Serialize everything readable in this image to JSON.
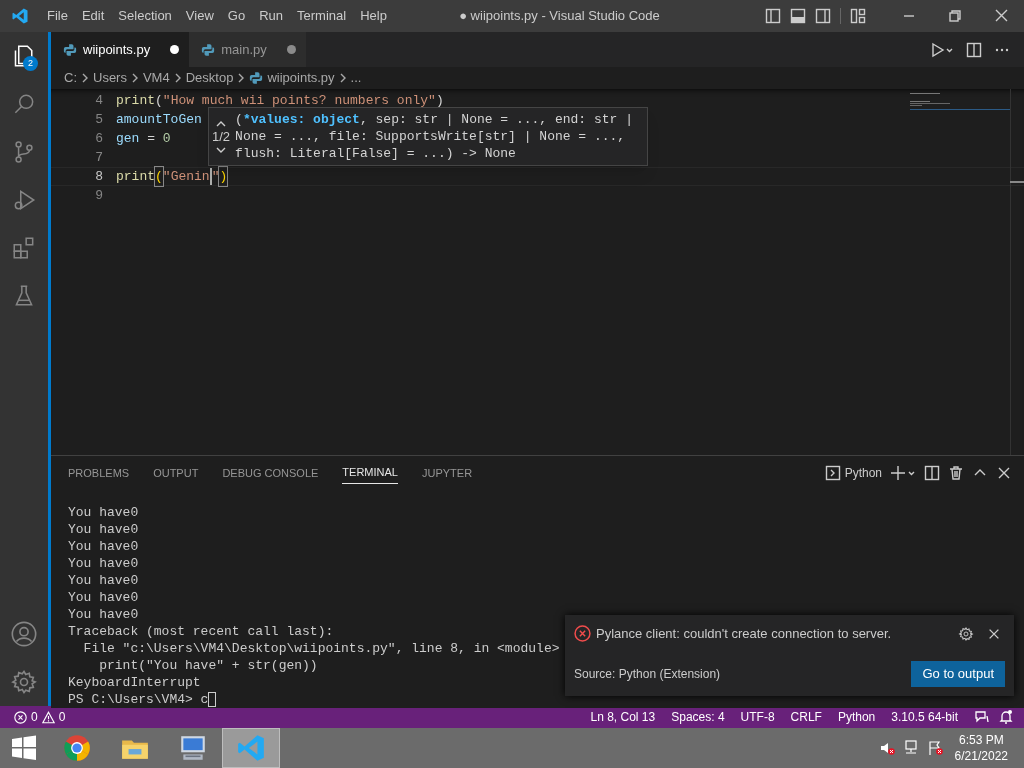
{
  "window": {
    "title": "● wiipoints.py - Visual Studio Code"
  },
  "menu": [
    "File",
    "Edit",
    "Selection",
    "View",
    "Go",
    "Run",
    "Terminal",
    "Help"
  ],
  "activity_bar": [
    {
      "kind": "files",
      "selected": true,
      "badge": "2"
    },
    {
      "kind": "search",
      "selected": false
    },
    {
      "kind": "source-control",
      "selected": false
    },
    {
      "kind": "run",
      "selected": false
    },
    {
      "kind": "extensions",
      "selected": false
    },
    {
      "kind": "testing",
      "selected": false
    }
  ],
  "tabs": [
    {
      "label": "wiipoints.py",
      "selected": true,
      "modified": true
    },
    {
      "label": "main.py",
      "selected": false,
      "modified": true
    }
  ],
  "breadcrumbs": [
    {
      "label": "C:",
      "kind": "folder"
    },
    {
      "label": "Users",
      "kind": "folder"
    },
    {
      "label": "VM4",
      "kind": "folder"
    },
    {
      "label": "Desktop",
      "kind": "folder"
    },
    {
      "label": "wiipoints.py",
      "kind": "file"
    },
    {
      "label": "...",
      "kind": "more"
    }
  ],
  "editor": {
    "lines": [
      {
        "number": "4",
        "current": false,
        "tokens": [
          {
            "kind": "fn",
            "text": "print"
          },
          {
            "kind": "op",
            "text": "("
          },
          {
            "kind": "str",
            "text": "\"How much wii points? numbers only\""
          },
          {
            "kind": "op",
            "text": ")"
          }
        ]
      },
      {
        "number": "5",
        "current": false,
        "tokens": [
          {
            "kind": "var",
            "text": "amountToGen"
          }
        ]
      },
      {
        "number": "6",
        "current": false,
        "tokens": [
          {
            "kind": "var",
            "text": "gen"
          },
          {
            "kind": "op",
            "text": " = "
          },
          {
            "kind": "num",
            "text": "0"
          }
        ]
      },
      {
        "number": "7",
        "current": false
      },
      {
        "number": "8",
        "current": true,
        "tokens": [
          {
            "kind": "fn",
            "text": "print"
          },
          {
            "kind": "match",
            "text": "("
          },
          {
            "kind": "str",
            "text": "\"Genin"
          },
          {
            "kind": "cursor"
          },
          {
            "kind": "str",
            "text": "\""
          },
          {
            "kind": "match",
            "text": ")"
          }
        ]
      },
      {
        "number": "9",
        "current": false
      }
    ]
  },
  "signature_help": {
    "counter": "1/2",
    "lines": [
      [
        {
          "kind": "plain",
          "text": "("
        },
        {
          "kind": "active",
          "text": "*values: object"
        },
        {
          "kind": "plain",
          "text": ", sep: str | None = ..., end: str |"
        }
      ],
      [
        {
          "kind": "plain",
          "text": "None = ..., file: SupportsWrite[str] | None = ...,"
        }
      ],
      [
        {
          "kind": "plain",
          "text": "flush: Literal[False] = ...) -> None"
        }
      ]
    ]
  },
  "panel": {
    "tabs": [
      {
        "label": "PROBLEMS",
        "selected": false
      },
      {
        "label": "OUTPUT",
        "selected": false
      },
      {
        "label": "DEBUG CONSOLE",
        "selected": false
      },
      {
        "label": "TERMINAL",
        "selected": true
      },
      {
        "label": "JUPYTER",
        "selected": false
      }
    ],
    "profile": "Python",
    "terminal_lines": [
      "You have0",
      "You have0",
      "You have0",
      "You have0",
      "You have0",
      "You have0",
      "You have0",
      "Traceback (most recent call last):",
      "  File \"c:\\Users\\VM4\\Desktop\\wiipoints.py\", line 8, in <module>",
      "    print(\"You have\" + str(gen))",
      "KeyboardInterrupt"
    ],
    "prompt": "PS C:\\Users\\VM4> c"
  },
  "notification": {
    "message": "Pylance client: couldn't create connection to server.",
    "source": "Source: Python (Extension)",
    "button": "Go to output"
  },
  "status_bar": {
    "errors": "0",
    "warnings": "0",
    "items": [
      "Ln 8, Col 13",
      "Spaces: 4",
      "UTF-8",
      "CRLF",
      "Python",
      "3.10.5 64-bit"
    ]
  },
  "taskbar": {
    "apps": [
      {
        "kind": "chrome",
        "selected": false
      },
      {
        "kind": "file-explorer",
        "selected": false
      },
      {
        "kind": "computer",
        "selected": false
      },
      {
        "kind": "vscode",
        "selected": true
      }
    ],
    "tray": [
      {
        "kind": "volume-muted"
      },
      {
        "kind": "network"
      },
      {
        "kind": "flag"
      }
    ],
    "time": "6:53 PM",
    "date": "6/21/2022"
  }
}
